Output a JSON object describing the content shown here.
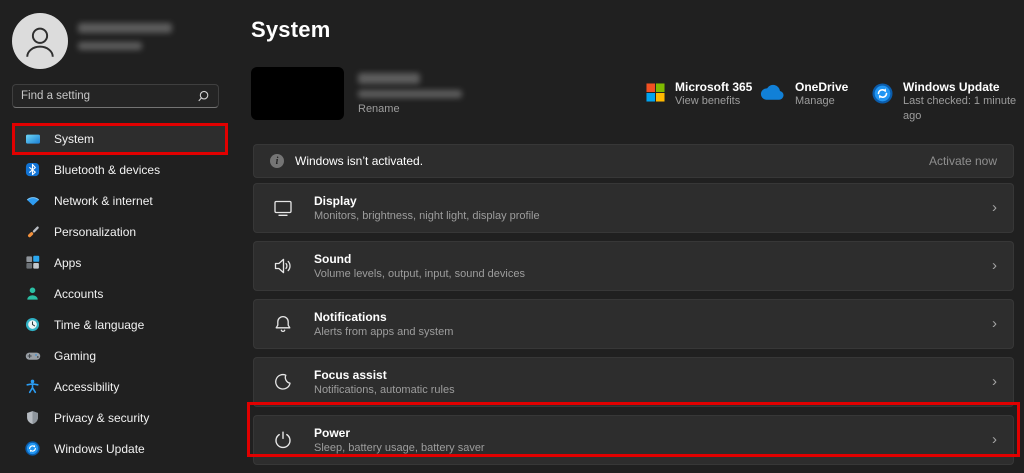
{
  "sidebar": {
    "profile": {
      "name_redacted": true,
      "subtitle_redacted": true
    },
    "search": {
      "placeholder": "Find a setting"
    },
    "items": [
      {
        "label": "System",
        "icon": "system-icon",
        "selected": true
      },
      {
        "label": "Bluetooth & devices",
        "icon": "bluetooth-icon"
      },
      {
        "label": "Network & internet",
        "icon": "network-icon"
      },
      {
        "label": "Personalization",
        "icon": "personalization-icon"
      },
      {
        "label": "Apps",
        "icon": "apps-icon"
      },
      {
        "label": "Accounts",
        "icon": "accounts-icon"
      },
      {
        "label": "Time & language",
        "icon": "time-language-icon"
      },
      {
        "label": "Gaming",
        "icon": "gaming-icon"
      },
      {
        "label": "Accessibility",
        "icon": "accessibility-icon"
      },
      {
        "label": "Privacy & security",
        "icon": "privacy-icon"
      },
      {
        "label": "Windows Update",
        "icon": "windows-update-icon"
      }
    ]
  },
  "header": {
    "title": "System",
    "device": {
      "thumbnail": "redacted-black",
      "name_redacted": true,
      "model_redacted": true,
      "rename_label": "Rename"
    },
    "quick_links": [
      {
        "title": "Microsoft 365",
        "subtitle": "View benefits",
        "icon": "microsoft-365-icon"
      },
      {
        "title": "OneDrive",
        "subtitle": "Manage",
        "icon": "onedrive-icon"
      },
      {
        "title": "Windows Update",
        "subtitle": "Last checked: 1 minute ago",
        "icon": "windows-update-icon"
      }
    ]
  },
  "banner": {
    "message": "Windows isn’t activated.",
    "action": "Activate now",
    "icon": "info-icon"
  },
  "settings_rows": [
    {
      "title": "Display",
      "subtitle": "Monitors, brightness, night light, display profile",
      "icon": "display-icon"
    },
    {
      "title": "Sound",
      "subtitle": "Volume levels, output, input, sound devices",
      "icon": "sound-icon"
    },
    {
      "title": "Notifications",
      "subtitle": "Alerts from apps and system",
      "icon": "notifications-icon"
    },
    {
      "title": "Focus assist",
      "subtitle": "Notifications, automatic rules",
      "icon": "focus-assist-icon"
    },
    {
      "title": "Power",
      "subtitle": "Sleep, battery usage, battery saver",
      "icon": "power-icon",
      "highlighted": true
    }
  ],
  "glyphs": {
    "chevron": "›",
    "info": "i"
  },
  "annotations": {
    "color": "#e10000",
    "boxes": [
      "sidebar-system-item",
      "power-row"
    ]
  },
  "colors": {
    "background": "#202020",
    "card": "#2d2d2d",
    "text_primary": "#ffffff",
    "text_secondary": "#9d9d9d",
    "annotation_red": "#e10000",
    "ms_logo": [
      "#f25022",
      "#7fba00",
      "#00a4ef",
      "#ffb900"
    ],
    "onedrive_blue": "#1180d7",
    "update_blue": "#2196f3"
  }
}
